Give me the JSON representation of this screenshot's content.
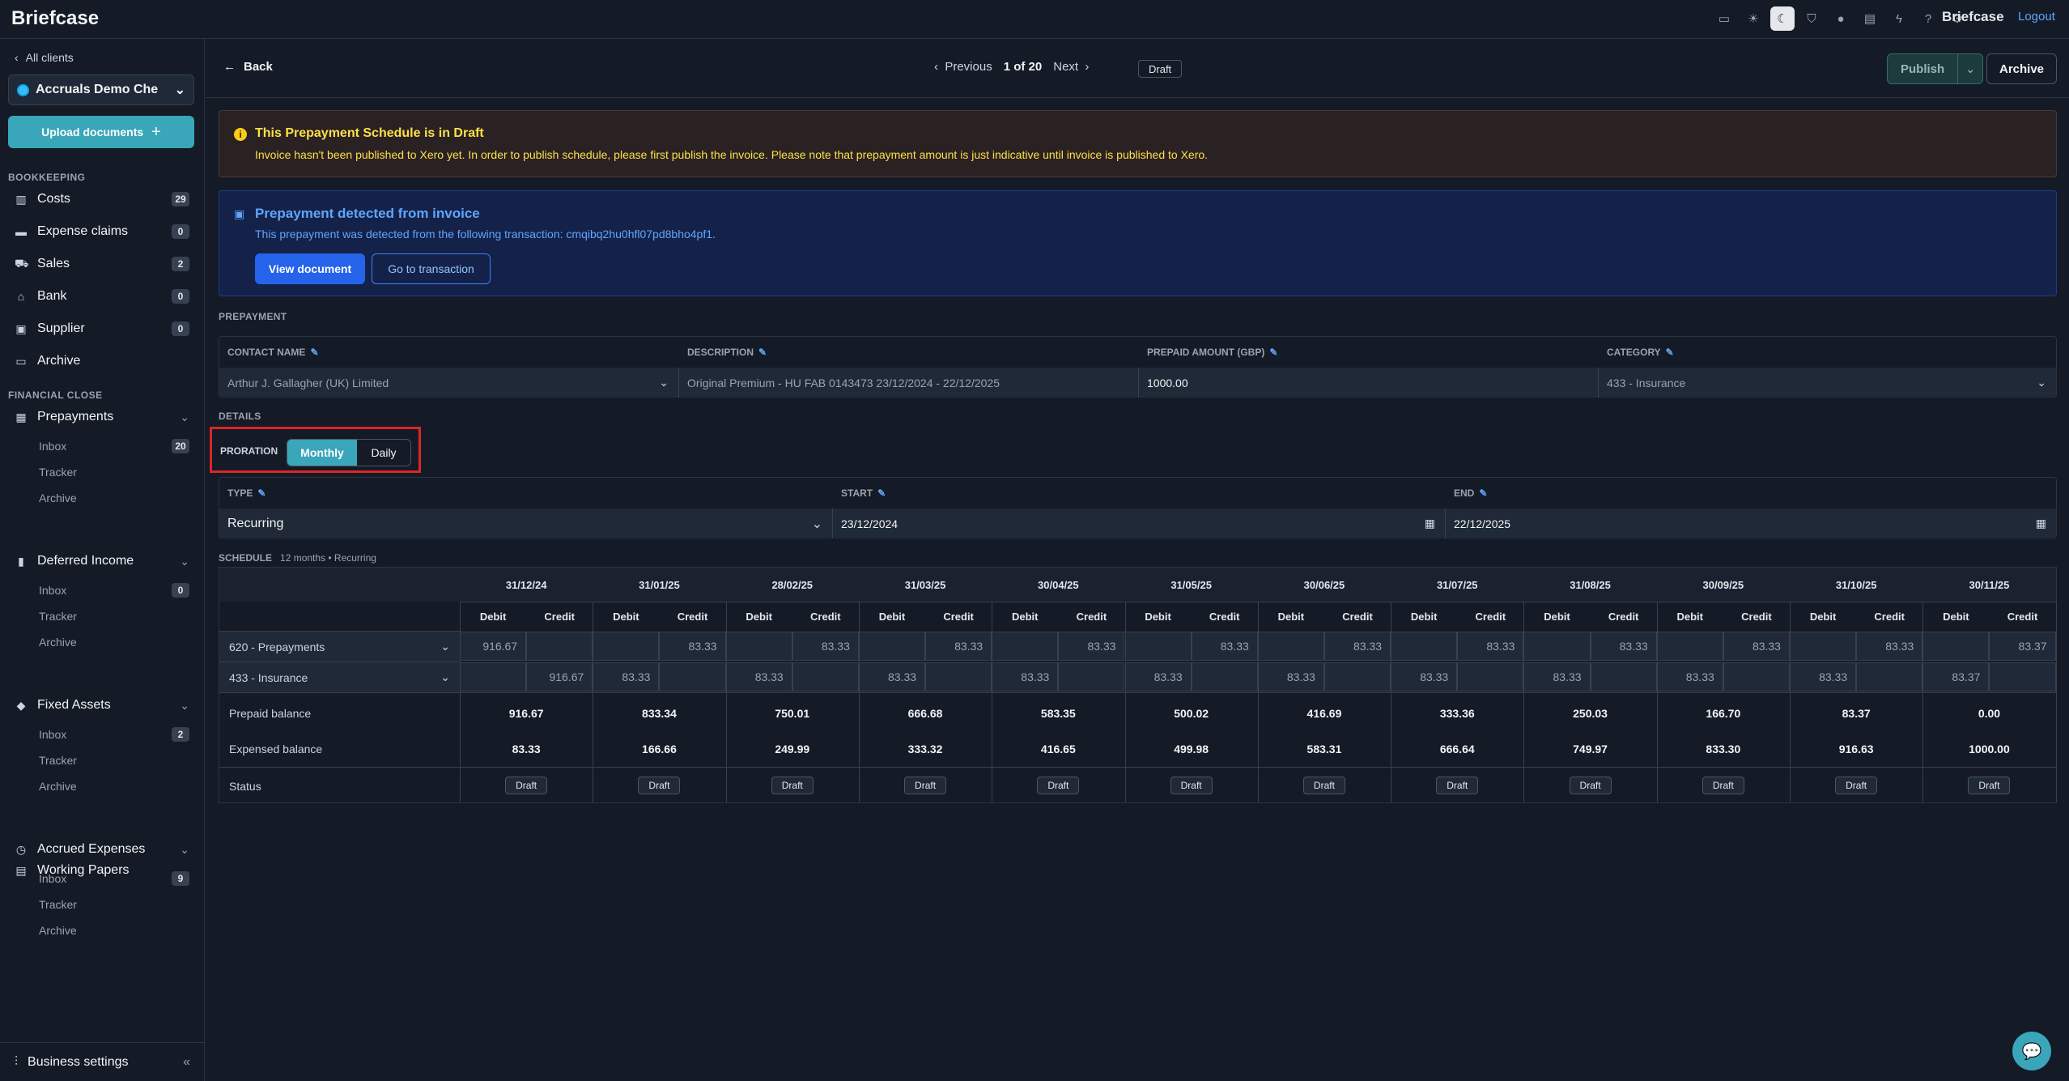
{
  "app": {
    "title": "Briefcase"
  },
  "topbar": {
    "icons": [
      "monitor-icon",
      "sun-icon",
      "moon-icon",
      "shield-icon",
      "circle-icon",
      "clipboard-icon",
      "bolt-icon",
      "help-icon",
      "gear-icon"
    ],
    "brand": "Briefcase",
    "logout": "Logout"
  },
  "sidebar": {
    "all_clients": "All clients",
    "client_name": "Accruals Demo Che",
    "upload": "Upload documents",
    "bookkeeping_title": "BOOKKEEPING",
    "bookkeeping": [
      {
        "label": "Costs",
        "count": "29",
        "icon": "receipt-icon"
      },
      {
        "label": "Expense claims",
        "count": "0",
        "icon": "card-icon"
      },
      {
        "label": "Sales",
        "count": "2",
        "icon": "cart-icon"
      },
      {
        "label": "Bank",
        "count": "0",
        "icon": "bank-icon"
      },
      {
        "label": "Supplier",
        "count": "0",
        "icon": "supplier-icon"
      },
      {
        "label": "Archive",
        "count": "",
        "icon": "archive-icon"
      }
    ],
    "financial_close_title": "FINANCIAL CLOSE",
    "groups": [
      {
        "label": "Prepayments",
        "icon": "calendar-icon",
        "items": [
          {
            "label": "Inbox",
            "count": "20"
          },
          {
            "label": "Tracker",
            "count": ""
          },
          {
            "label": "Archive",
            "count": ""
          }
        ]
      },
      {
        "label": "Deferred Income",
        "icon": "bar-chart-icon",
        "items": [
          {
            "label": "Inbox",
            "count": "0"
          },
          {
            "label": "Tracker",
            "count": ""
          },
          {
            "label": "Archive",
            "count": ""
          }
        ]
      },
      {
        "label": "Fixed Assets",
        "icon": "cube-icon",
        "items": [
          {
            "label": "Inbox",
            "count": "2"
          },
          {
            "label": "Tracker",
            "count": ""
          },
          {
            "label": "Archive",
            "count": ""
          }
        ]
      },
      {
        "label": "Accrued Expenses",
        "icon": "clock-icon",
        "items": [
          {
            "label": "Inbox",
            "count": "9"
          },
          {
            "label": "Tracker",
            "count": ""
          },
          {
            "label": "Archive",
            "count": ""
          }
        ]
      }
    ],
    "working_papers": "Working Papers",
    "business_settings": "Business settings"
  },
  "header": {
    "back": "Back",
    "previous": "Previous",
    "position": "1 of 20",
    "next": "Next",
    "status": "Draft",
    "publish": "Publish",
    "archive": "Archive"
  },
  "warning": {
    "title": "This Prepayment Schedule is in Draft",
    "body": "Invoice hasn't been published to Xero yet. In order to publish schedule, please first publish the invoice. Please note that prepayment amount is just indicative until invoice is published to Xero."
  },
  "info": {
    "title": "Prepayment detected from invoice",
    "body": "This prepayment was detected from the following transaction: cmqibq2hu0hfl07pd8bho4pf1.",
    "view_document": "View document",
    "go_to_transaction": "Go to transaction"
  },
  "prepayment": {
    "section": "PREPAYMENT",
    "contact_label": "CONTACT NAME",
    "contact_value": "Arthur J. Gallagher (UK) Limited",
    "description_label": "DESCRIPTION",
    "description_value": "Original Premium - HU FAB 0143473 23/12/2024 - 22/12/2025",
    "amount_label": "PREPAID AMOUNT (GBP)",
    "amount_value": "1000.00",
    "category_label": "CATEGORY",
    "category_value": "433 - Insurance"
  },
  "details": {
    "section": "DETAILS",
    "proration_label": "PRORATION",
    "monthly": "Monthly",
    "daily": "Daily",
    "type_label": "TYPE",
    "type_value": "Recurring",
    "start_label": "START",
    "start_value": "23/12/2024",
    "end_label": "END",
    "end_value": "22/12/2025"
  },
  "schedule": {
    "title": "SCHEDULE",
    "meta": "12 months • Recurring",
    "debit": "Debit",
    "credit": "Credit",
    "months": [
      "31/12/24",
      "31/01/25",
      "28/02/25",
      "31/03/25",
      "30/04/25",
      "31/05/25",
      "30/06/25",
      "31/07/25",
      "31/08/25",
      "30/09/25",
      "31/10/25",
      "30/11/25"
    ],
    "rows": [
      {
        "account": "620 - Prepayments",
        "debit": [
          "916.67",
          "",
          "",
          "",
          "",
          "",
          "",
          "",
          "",
          "",
          "",
          ""
        ],
        "credit": [
          "",
          "83.33",
          "83.33",
          "83.33",
          "83.33",
          "83.33",
          "83.33",
          "83.33",
          "83.33",
          "83.33",
          "83.33",
          "83.37"
        ]
      },
      {
        "account": "433 - Insurance",
        "debit": [
          "",
          "83.33",
          "83.33",
          "83.33",
          "83.33",
          "83.33",
          "83.33",
          "83.33",
          "83.33",
          "83.33",
          "83.33",
          "83.37"
        ],
        "credit": [
          "916.67",
          "",
          "",
          "",
          "",
          "",
          "",
          "",
          "",
          "",
          "",
          ""
        ]
      }
    ],
    "prepaid_label": "Prepaid balance",
    "prepaid": [
      "916.67",
      "833.34",
      "750.01",
      "666.68",
      "583.35",
      "500.02",
      "416.69",
      "333.36",
      "250.03",
      "166.70",
      "83.37",
      "0.00"
    ],
    "expensed_label": "Expensed balance",
    "expensed": [
      "83.33",
      "166.66",
      "249.99",
      "333.32",
      "416.65",
      "499.98",
      "583.31",
      "666.64",
      "749.97",
      "833.30",
      "916.63",
      "1000.00"
    ],
    "status_label": "Status",
    "status": [
      "Draft",
      "Draft",
      "Draft",
      "Draft",
      "Draft",
      "Draft",
      "Draft",
      "Draft",
      "Draft",
      "Draft",
      "Draft",
      "Draft"
    ]
  },
  "colors": {
    "accent": "#3aa6b9",
    "background": "#141b26",
    "warning": "#fde047",
    "info": "#60a5fa",
    "highlight": "#dc2626"
  }
}
